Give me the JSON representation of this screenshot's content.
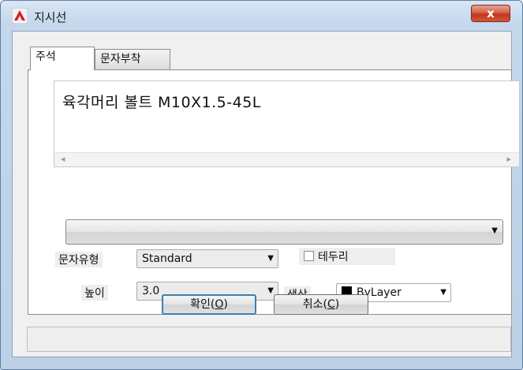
{
  "window": {
    "title": "지시선",
    "close_label": "x"
  },
  "tabs": [
    {
      "label": "주석",
      "active": true
    },
    {
      "label": "문자부착",
      "active": false
    }
  ],
  "annotation": {
    "text": "육각머리 볼트  M10X1.5-45L",
    "scroll_left": "◂",
    "scroll_right": "▸"
  },
  "leader_combo": {
    "value": "",
    "arrow": "▼"
  },
  "text_style": {
    "label": "문자유형",
    "value": "Standard"
  },
  "frame": {
    "label": "테두리",
    "checked": false
  },
  "height": {
    "label": "높이",
    "value": "3.0"
  },
  "color": {
    "label": "색상",
    "value": "ByLayer",
    "swatch_color": "#000000"
  },
  "buttons": {
    "ok_label": "확인(",
    "ok_key": "O",
    "cancel_label": "취소(",
    "cancel_key": "C",
    "close_paren": ")"
  },
  "colors": {
    "close_button": "#c9472c",
    "default_button_border": "#3c7fb1"
  }
}
